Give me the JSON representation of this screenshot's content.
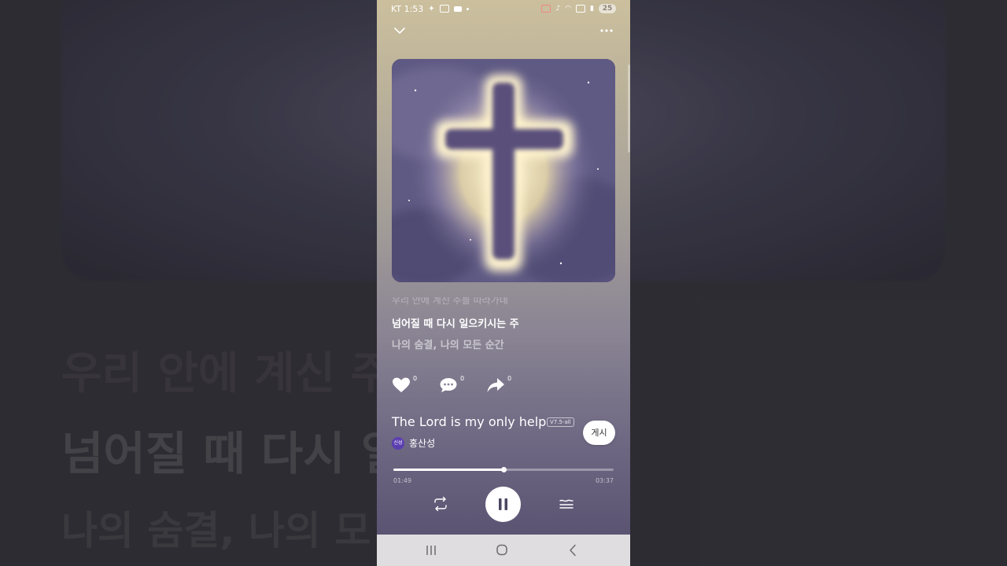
{
  "status_bar": {
    "carrier_time": "KT 1:53",
    "battery": "25"
  },
  "lyrics": {
    "previous": "우리 안에 계신 주를 따라가네",
    "current": "넘어질 때 다시 일으키시는 주",
    "next": "나의 숨결, 나의 모든 순간"
  },
  "actions": {
    "like_count": "0",
    "comment_count": "0",
    "share_count": "0"
  },
  "track": {
    "title": "The Lord is my only help",
    "version": "V7.5-all",
    "artist_avatar": "신성",
    "artist": "홍산성",
    "post_label": "게시"
  },
  "playback": {
    "elapsed": "01:49",
    "total": "03:37",
    "progress": 0.5
  },
  "background": {
    "line1": "넘어질 때 다시 일",
    "line2": "나의 숨결, 나의 모"
  }
}
